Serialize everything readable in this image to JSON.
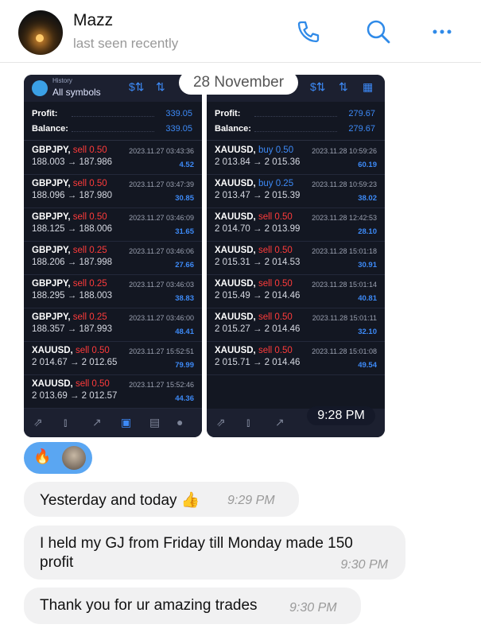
{
  "header": {
    "contact_name": "Mazz",
    "contact_status": "last seen recently",
    "icons": [
      "phone-icon",
      "search-icon",
      "more-icon"
    ]
  },
  "date_separator": "28 November",
  "screenshot_left": {
    "history_label": "History",
    "filter_label": "All symbols",
    "profit_label": "Profit:",
    "profit_value": "339.05",
    "balance_label": "Balance:",
    "balance_value": "339.05",
    "trades": [
      {
        "symbol": "GBPJPY,",
        "side": "sell 0.50",
        "type": "sell",
        "time": "2023.11.27 03:43:36",
        "prices": "188.003 → 187.986",
        "profit": "4.52"
      },
      {
        "symbol": "GBPJPY,",
        "side": "sell 0.50",
        "type": "sell",
        "time": "2023.11.27 03:47:39",
        "prices": "188.096 → 187.980",
        "profit": "30.85"
      },
      {
        "symbol": "GBPJPY,",
        "side": "sell 0.50",
        "type": "sell",
        "time": "2023.11.27 03:46:09",
        "prices": "188.125 → 188.006",
        "profit": "31.65"
      },
      {
        "symbol": "GBPJPY,",
        "side": "sell 0.25",
        "type": "sell",
        "time": "2023.11.27 03:46:06",
        "prices": "188.206 → 187.998",
        "profit": "27.66"
      },
      {
        "symbol": "GBPJPY,",
        "side": "sell 0.25",
        "type": "sell",
        "time": "2023.11.27 03:46:03",
        "prices": "188.295 → 188.003",
        "profit": "38.83"
      },
      {
        "symbol": "GBPJPY,",
        "side": "sell 0.25",
        "type": "sell",
        "time": "2023.11.27 03:46:00",
        "prices": "188.357 → 187.993",
        "profit": "48.41"
      },
      {
        "symbol": "XAUUSD,",
        "side": "sell 0.50",
        "type": "sell",
        "time": "2023.11.27 15:52:51",
        "prices": "2 014.67 → 2 012.65",
        "profit": "79.99"
      },
      {
        "symbol": "XAUUSD,",
        "side": "sell 0.50",
        "type": "sell",
        "time": "2023.11.27 15:52:46",
        "prices": "2 013.69 → 2 012.57",
        "profit": "44.36"
      }
    ]
  },
  "screenshot_right": {
    "profit_label": "Profit:",
    "profit_value": "279.67",
    "balance_label": "Balance:",
    "balance_value": "279.67",
    "trades": [
      {
        "symbol": "XAUUSD,",
        "side": "buy 0.50",
        "type": "buy",
        "time": "2023.11.28 10:59:26",
        "prices": "2 013.84 → 2 015.36",
        "profit": "60.19"
      },
      {
        "symbol": "XAUUSD,",
        "side": "buy 0.25",
        "type": "buy",
        "time": "2023.11.28 10:59:23",
        "prices": "2 013.47 → 2 015.39",
        "profit": "38.02"
      },
      {
        "symbol": "XAUUSD,",
        "side": "sell 0.50",
        "type": "sell",
        "time": "2023.11.28 12:42:53",
        "prices": "2 014.70 → 2 013.99",
        "profit": "28.10"
      },
      {
        "symbol": "XAUUSD,",
        "side": "sell 0.50",
        "type": "sell",
        "time": "2023.11.28 15:01:18",
        "prices": "2 015.31 → 2 014.53",
        "profit": "30.91"
      },
      {
        "symbol": "XAUUSD,",
        "side": "sell 0.50",
        "type": "sell",
        "time": "2023.11.28 15:01:14",
        "prices": "2 015.49 → 2 014.46",
        "profit": "40.81"
      },
      {
        "symbol": "XAUUSD,",
        "side": "sell 0.50",
        "type": "sell",
        "time": "2023.11.28 15:01:11",
        "prices": "2 015.27 → 2 014.46",
        "profit": "32.10"
      },
      {
        "symbol": "XAUUSD,",
        "side": "sell 0.50",
        "type": "sell",
        "time": "2023.11.28 15:01:08",
        "prices": "2 015.71 → 2 014.46",
        "profit": "49.54"
      }
    ]
  },
  "photo_time": "9:28 PM",
  "reactions": {
    "emoji": "🔥"
  },
  "messages": [
    {
      "text": "Yesterday and today 👍",
      "time": "9:29 PM"
    },
    {
      "text": "I held my GJ from Friday till Monday made 150 profit",
      "time": "9:30 PM"
    },
    {
      "text": "Thank you for ur amazing trades",
      "time": "9:30 PM"
    }
  ],
  "colors": {
    "accent": "#2f8ae8",
    "sell": "#ff3b3b",
    "buy": "#3d8af7",
    "panel": "#131722"
  }
}
